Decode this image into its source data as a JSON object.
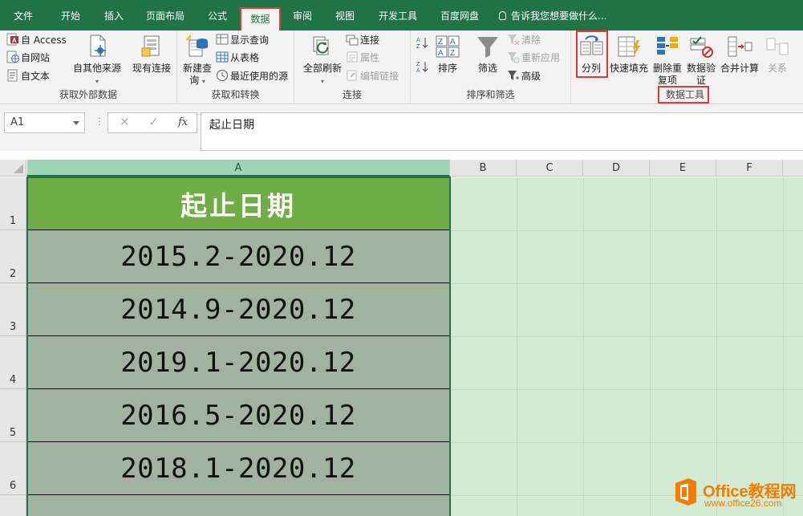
{
  "menu": {
    "tabs": [
      "文件",
      "开始",
      "插入",
      "页面布局",
      "公式",
      "数据",
      "审阅",
      "视图",
      "开发工具",
      "百度网盘"
    ],
    "active_tab": "数据",
    "tell_me": "告诉我您想要做什么..."
  },
  "ribbon": {
    "get_external": {
      "label": "获取外部数据",
      "access": "自 Access",
      "web": "自网站",
      "text": "自文本",
      "other": "自其他来源"
    },
    "existing": "现有连接",
    "get_transform": {
      "label": "获取和转换",
      "new_query": "新建查询",
      "show_queries": "显示查询",
      "from_table": "从表格",
      "recent_sources": "最近使用的源"
    },
    "connections": {
      "label": "连接",
      "refresh_all": "全部刷新",
      "connections": "连接",
      "properties": "属性",
      "edit_links": "编辑链接"
    },
    "sort_filter": {
      "label": "排序和筛选",
      "sort": "排序",
      "filter": "筛选",
      "clear": "清除",
      "reapply": "重新应用",
      "advanced": "高级"
    },
    "data_tools": {
      "label": "数据工具",
      "text_to_columns": "分列",
      "flash_fill": "快速填充",
      "remove_dup": "删除重复项",
      "validation": "数据验证",
      "consolidate": "合并计算",
      "relationships": "关系"
    }
  },
  "formula_bar": {
    "name_box": "A1",
    "fx": "fx",
    "content": "起止日期"
  },
  "sheet": {
    "columns": [
      "A",
      "B",
      "C",
      "D",
      "E",
      "F"
    ],
    "rows": [
      "1",
      "2",
      "3",
      "4",
      "5",
      "6"
    ],
    "cells_A": [
      "起止日期",
      "2015.2-2020.12",
      "2014.9-2020.12",
      "2019.1-2020.12",
      "2016.5-2020.12",
      "2018.1-2020.12"
    ]
  },
  "watermark": {
    "title": "Office教程网",
    "url": "www.office26.com"
  },
  "colors": {
    "excel_green": "#217346",
    "header_cell": "#70ad47",
    "data_cell": "#9fb39f",
    "sheet_bg": "#d3ead3",
    "highlight_red": "#e53935"
  }
}
